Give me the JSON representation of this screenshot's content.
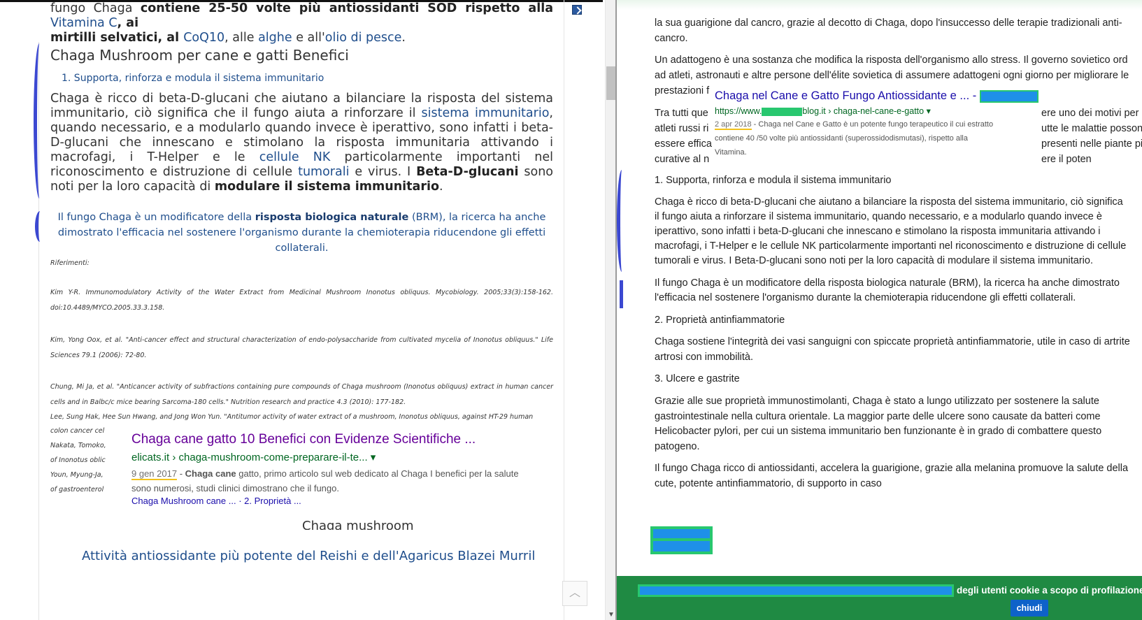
{
  "left": {
    "intro": {
      "l1_a": "fungo Chaga ",
      "l1_b": "contiene 25-50 volte più antiossidanti SOD rispetto alla ",
      "l1_link": "Vitamina C",
      "l1_c": ", ai",
      "l2_a": "mirtilli selvatici, al ",
      "l2_link1": "CoQ10",
      "l2_b": ", alle ",
      "l2_link2": "alghe",
      "l2_c": " e all'",
      "l2_link3": "olio di pesce",
      "l2_d": "."
    },
    "heading": "Chaga Mushroom per cane e gatti Benefici",
    "list_item": "1. Supporta, rinforza e modula il sistema immunitario",
    "para1": {
      "a": "Chaga è ricco di beta-D-glucani che aiutano a bilanciare la risposta del sistema immunitario, ciò significa che il fungo aiuta a rinforzare il ",
      "link1": "sistema immunitario",
      "b": ", quando necessario, e a modularlo quando invece è iperattivo, sono infatti i beta-D-glucani che innescano e stimolano la risposta immunitaria attivando i macrofagi, i T-Helper e le ",
      "link2": "cellule NK",
      "c": " particolarmente importanti nel riconoscimento e distruzione di cellule ",
      "link3": "tumorali",
      "d": " e virus. I ",
      "bold1": "Beta-D-glucani",
      "e": " sono noti per la loro capacità di ",
      "bold2": "modulare il sistema immunitario",
      "f": "."
    },
    "para2": {
      "a": "Il fungo Chaga è un modificatore della ",
      "bold": "risposta biologica naturale",
      "b": " (BRM), la ricerca ha anche dimostrato l'efficacia nel sostenere l'organismo durante la chemioterapia riducendone gli effetti collaterali."
    },
    "refs_title": "Riferimenti:",
    "refs": [
      "Kim Y-R. Immunomodulatory Activity of the Water Extract from Medicinal Mushroom Inonotus obliquus. Mycobiology. 2005;33(3):158-162. doi:10.4489/MYCO.2005.33.3.158.",
      "Kim, Yong Oox, et al. \"Anti-cancer effect and structural characterization of endo-polysaccharide from cultivated mycelia of Inonotus obliquus.\" Life Sciences 79.1 (2006): 72-80.",
      "Chung, Mi Ja, et al. \"Anticancer activity of subfractions containing pure compounds of Chaga mushroom (Inonotus obliquus) extract in human cancer cells and in Balbc/c mice bearing Sarcoma-180 cells.\" Nutrition research and practice 4.3 (2010): 177-182.",
      "Lee, Sung Hak, Hee Sun Hwang, and Jong Won Yun. \"Antitumor activity of water extract of a mushroom, Inonotus obliquus, against HT-29 human"
    ],
    "ref_fragments": [
      "colon cancer cel",
      "Nakata, Tomoko,",
      "of Inonotus oblic",
      "Youn, Myung-Ja,",
      "of gastroenterol"
    ],
    "serp": {
      "title": "Chaga cane gatto 10 Benefici con Evidenze Scientifiche ...",
      "url": "elicats.it › chaga-mushroom-come-preparare-il-te...",
      "url_arrow": "▾",
      "date": "9 gen 2017",
      "snippet_a": " - ",
      "snippet_bold": "Chaga cane",
      "snippet_b": " gatto, primo articolo sul web dedicato al Chaga I benefici per la salute sono numerosi, studi clinici dimostrano che il fungo.",
      "link1": "Chaga Mushroom cane ...",
      "link_sep": " · ",
      "link2": "2. Proprietà ..."
    },
    "cut_heading": "Chaga mushroom",
    "subheading": "Attività antiossidante più potente del Reishi e dell'Agaricus Blazei Murril",
    "back_to_top": "︿"
  },
  "right": {
    "top_partial": "la sua guarigione dal cancro, grazie al decotto di Chaga, dopo l'insuccesso delle terapie tradizionali anti-",
    "top_partial2": "cancro.",
    "adapt_1": "Un adattogeno è una sostanza che modifica la risposta dell'organismo allo stress. Il governo sovietico ord",
    "adapt_2": "ad atleti, astronauti e altre persone dell'élite sovietica di assumere adattogeni ogni giorno per migliorare le",
    "adapt_3": "prestazioni f",
    "tra_left": [
      "Tra tutti que",
      "atleti russi ri",
      "essere effica",
      "curative al n"
    ],
    "tra_right": [
      "ere uno dei motivi per cu",
      "utte le malattie possono",
      "presenti nelle piante più",
      "ere il poten"
    ],
    "serp": {
      "title": "Chaga nel Cane e Gatto Fungo Antiossidante e ... -",
      "url_a": "https://www.",
      "url_b": "blog.it › chaga-nel-cane-e-gatto",
      "url_arrow": "▾",
      "date": "2 apr 2018",
      "snippet": " - Chaga nel Cane e Gatto è un potente fungo terapeutico il cui estratto contiene 40 /50 volte più antiossidanti (superossidodismutasi), rispetto alla Vitamina."
    },
    "item1": "1. Supporta, rinforza e modula il sistema immunitario",
    "p1": [
      "Chaga è ricco di beta-D-glucani che aiutano a bilanciare la risposta del sistema immunitario, ciò significa",
      "il fungo aiuta a rinforzare il sistema immunitario, quando necessario, e a modularlo quando invece è",
      "iperattivo, sono infatti i beta-D-glucani che innescano e stimolano la risposta immunitaria attivando i",
      "macrofagi, i T-Helper e le cellule NK particolarmente importanti nel riconoscimento e distruzione di cellule",
      "tumorali e virus. I Beta-D-glucani sono noti per la loro capacità di modulare il sistema immunitario."
    ],
    "p2": [
      "Il fungo Chaga è un modificatore della risposta biologica naturale (BRM), la ricerca ha anche dimostrato",
      "l'efficacia nel sostenere l'organismo durante la chemioterapia riducendone gli effetti collaterali."
    ],
    "item2": "2. Proprietà antinfiammatorie",
    "p3": [
      "Chaga sostiene l'integrità dei vasi sanguigni con spiccate proprietà antinfiammatorie, utile in caso di artrite",
      "artrosi con immobilità."
    ],
    "item3": "3. Ulcere e gastrite",
    "p4": [
      "Grazie alle sue proprietà immunostimolanti, Chaga è stato a lungo utilizzato per sostenere la salute",
      "gastrointestinale nella cultura orientale. La maggior parte delle ulcere sono causate da batteri come",
      "Helicobacter pylori, per cui un sistema immunitario ben funzionante è in grado di combattere questo",
      "patogeno."
    ],
    "p5": [
      "Il fungo Chaga ricco di antiossidanti, accelera la guarigione, grazie alla melanina promuove la salute della",
      "cute, potente antinfiammatorio, di supporto in caso"
    ],
    "cookie": {
      "text": "degli utenti cookie a scopo di profilazione e di t",
      "close": "chiudi"
    }
  }
}
